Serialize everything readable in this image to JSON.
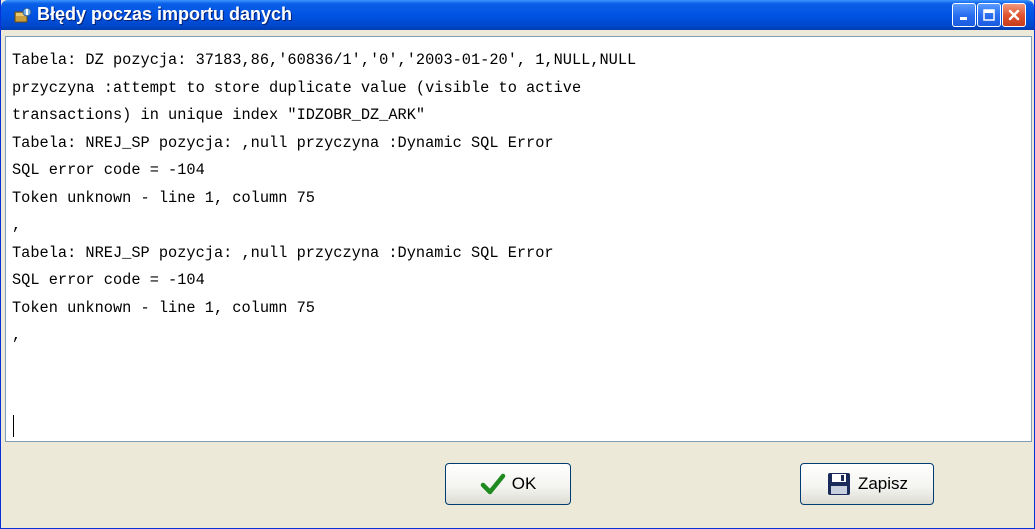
{
  "window": {
    "title": "Błędy poczas importu danych",
    "accent_color": "#0054e3",
    "close_color": "#e0552f"
  },
  "titlebar": {
    "icon": "app-icon",
    "controls": [
      {
        "name": "minimize",
        "icon": "minimize-icon"
      },
      {
        "name": "maximize",
        "icon": "maximize-icon"
      },
      {
        "name": "close",
        "icon": "close-icon"
      }
    ]
  },
  "log": {
    "lines": [
      "Tabela: DZ pozycja: 37183,86,'60836/1','0','2003-01-20', 1,NULL,NULL",
      "przyczyna :attempt to store duplicate value (visible to active",
      "transactions) in unique index \"IDZOBR_DZ_ARK\"",
      "Tabela: NREJ_SP pozycja: ,null przyczyna :Dynamic SQL Error",
      "SQL error code = -104",
      "Token unknown - line 1, column 75",
      ",",
      "Tabela: NREJ_SP pozycja: ,null przyczyna :Dynamic SQL Error",
      "SQL error code = -104",
      "Token unknown - line 1, column 75",
      ","
    ]
  },
  "buttons": {
    "ok_label": "OK",
    "ok_icon": "checkmark-icon",
    "save_label": "Zapisz",
    "save_icon": "floppy-disk-icon"
  }
}
